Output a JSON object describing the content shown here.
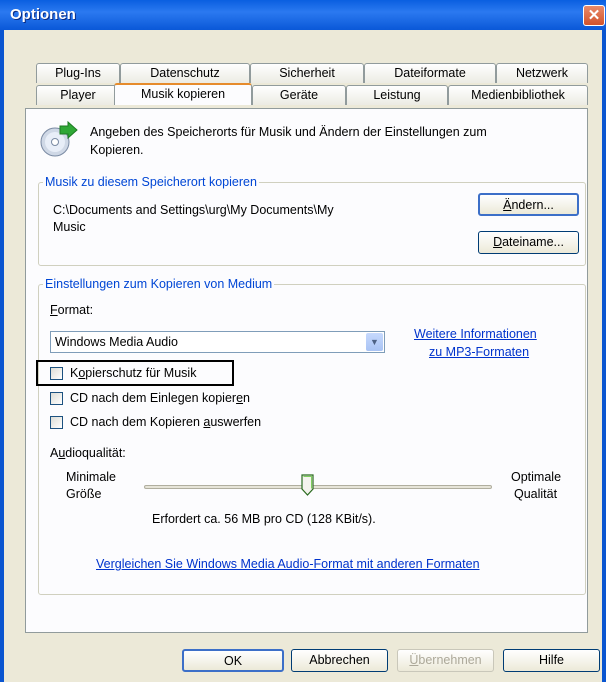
{
  "window": {
    "title": "Optionen",
    "close_glyph": "✕"
  },
  "tabs_row1": [
    "Plug-Ins",
    "Datenschutz",
    "Sicherheit",
    "Dateiformate",
    "Netzwerk"
  ],
  "tabs_row2": [
    "Player",
    "Musik kopieren",
    "Geräte",
    "Leistung",
    "Medienbibliothek"
  ],
  "active_tab": "Musik kopieren",
  "intro": {
    "icon": "cd-rip-icon",
    "text_line1": "Angeben des Speicherorts für Musik und Ändern der Einstellungen zum",
    "text_line2": "Kopieren."
  },
  "location_group": {
    "title": "Musik zu diesem Speicherort kopieren",
    "path_line1": "C:\\Documents and Settings\\urg\\My Documents\\My",
    "path_line2": "Music",
    "change_button": {
      "accel": "Ä",
      "rest": "ndern..."
    },
    "filename_button": {
      "accel": "D",
      "rest": "ateiname..."
    }
  },
  "settings_group": {
    "title": "Einstellungen zum Kopieren von Medium",
    "format_label": {
      "accel": "F",
      "rest": "ormat:"
    },
    "format_value": "Windows Media Audio",
    "more_info_link_line1": "Weitere Informationen",
    "more_info_link_line2": "zu MP3-Formaten",
    "checkboxes": [
      {
        "pre": "K",
        "accel": "o",
        "post": "pierschutz für Musik",
        "checked": false
      },
      {
        "pre": "CD nach dem Einlegen kopier",
        "accel": "e",
        "post": "n",
        "checked": false
      },
      {
        "pre": "CD nach dem Kopieren ",
        "accel": "a",
        "post": "uswerfen",
        "checked": false
      }
    ],
    "quality_label": {
      "pre": "A",
      "accel": "u",
      "post": "dioqualität:"
    },
    "min_label_line1": "Minimale",
    "min_label_line2": "Größe",
    "max_label_line1": "Optimale",
    "max_label_line2": "Qualität",
    "slider_level_percent": 47,
    "size_info": "Erfordert ca. 56 MB pro CD (128 KBit/s).",
    "compare_link": "Vergleichen Sie Windows Media Audio-Format mit anderen Formaten"
  },
  "footer": {
    "ok": "OK",
    "cancel": "Abbrechen",
    "apply": {
      "accel": "Ü",
      "rest": "bernehmen"
    },
    "help": "Hilfe"
  }
}
